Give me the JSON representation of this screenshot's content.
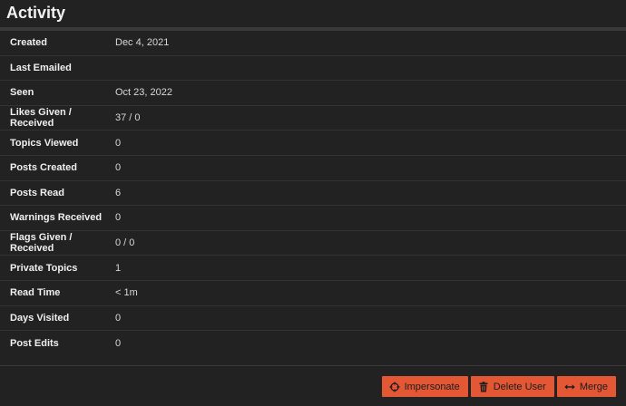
{
  "header": {
    "title": "Activity"
  },
  "rows": [
    {
      "label": "Created",
      "value": "Dec 4, 2021"
    },
    {
      "label": "Last Emailed",
      "value": ""
    },
    {
      "label": "Seen",
      "value": "Oct 23, 2022"
    },
    {
      "label": "Likes Given / Received",
      "value": "37 / 0"
    },
    {
      "label": "Topics Viewed",
      "value": "0"
    },
    {
      "label": "Posts Created",
      "value": "0"
    },
    {
      "label": "Posts Read",
      "value": "6"
    },
    {
      "label": "Warnings Received",
      "value": "0"
    },
    {
      "label": "Flags Given / Received",
      "value": "0 / 0"
    },
    {
      "label": "Private Topics",
      "value": "1"
    },
    {
      "label": "Read Time",
      "value": "< 1m"
    },
    {
      "label": "Days Visited",
      "value": "0"
    },
    {
      "label": "Post Edits",
      "value": "0"
    }
  ],
  "actions": {
    "impersonate": {
      "label": "Impersonate",
      "icon": "crosshairs-icon"
    },
    "delete_user": {
      "label": "Delete User",
      "icon": "trash-icon"
    },
    "merge": {
      "label": "Merge",
      "icon": "arrows-left-right-icon"
    }
  },
  "colors": {
    "background": "#222222",
    "button": "#e45735",
    "button_text": "#1c1c1c"
  }
}
